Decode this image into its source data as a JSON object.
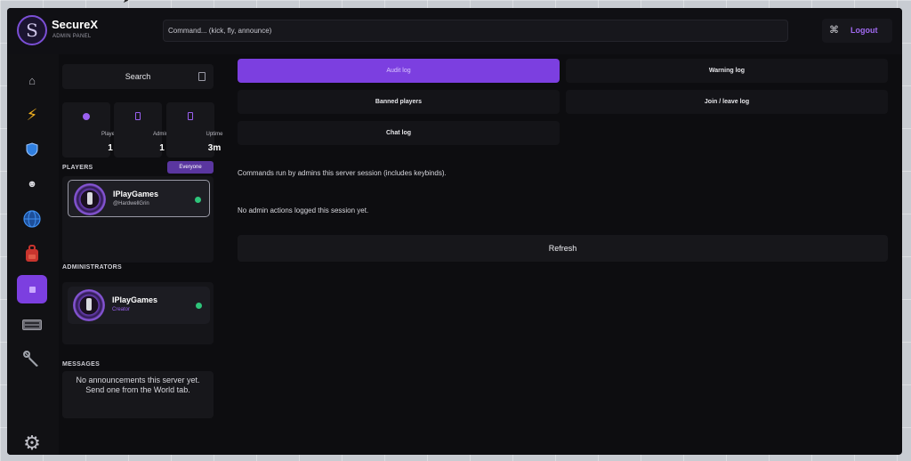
{
  "app": {
    "name": "SecureX",
    "subtitle": "ADMIN PANEL",
    "logo_glyph": "S"
  },
  "header": {
    "command_placeholder": "Command... (kick, fly, announce)",
    "logout_label": "Logout"
  },
  "rail": [
    {
      "name": "home-icon",
      "glyph": "⌂"
    },
    {
      "name": "lightning-icon",
      "glyph": "⚡"
    },
    {
      "name": "shield-icon",
      "glyph": "🛡"
    },
    {
      "name": "smile-icon",
      "glyph": "☻"
    },
    {
      "name": "globe-icon",
      "glyph": "🌐"
    },
    {
      "name": "backpack-icon",
      "glyph": "🎒"
    },
    {
      "name": "logs-icon",
      "glyph": "▪",
      "active": true
    },
    {
      "name": "keyboard-icon",
      "glyph": "⌨"
    },
    {
      "name": "wrench-icon",
      "glyph": "🔧"
    },
    {
      "name": "settings-icon",
      "glyph": "⚙"
    }
  ],
  "search": {
    "label": "Search"
  },
  "stats": [
    {
      "label": "Players",
      "value": "1"
    },
    {
      "label": "Admins",
      "value": "1"
    },
    {
      "label": "Uptime",
      "value": "3m"
    }
  ],
  "players": {
    "title": "PLAYERS",
    "filter": "Everyone",
    "items": [
      {
        "name": "IPlayGames",
        "handle": "@HardwellGrin"
      }
    ]
  },
  "administrators": {
    "title": "ADMINISTRATORS",
    "items": [
      {
        "name": "IPlayGames",
        "role": "Creator"
      }
    ]
  },
  "messages": {
    "title": "MESSAGES",
    "empty_line1": "No announcements this server yet.",
    "empty_line2": "Send one from the World tab."
  },
  "tabs": [
    {
      "label": "Audit log",
      "active": true
    },
    {
      "label": "Warning log"
    },
    {
      "label": "Banned players"
    },
    {
      "label": "Join / leave log"
    },
    {
      "label": "Chat log"
    }
  ],
  "main": {
    "description": "Commands run by admins this server session (includes keybinds).",
    "empty_state": "No admin actions logged this session yet.",
    "refresh_label": "Refresh"
  },
  "colors": {
    "accent": "#7c3fe0",
    "online": "#2ec47a",
    "creator": "#9a60f0"
  }
}
